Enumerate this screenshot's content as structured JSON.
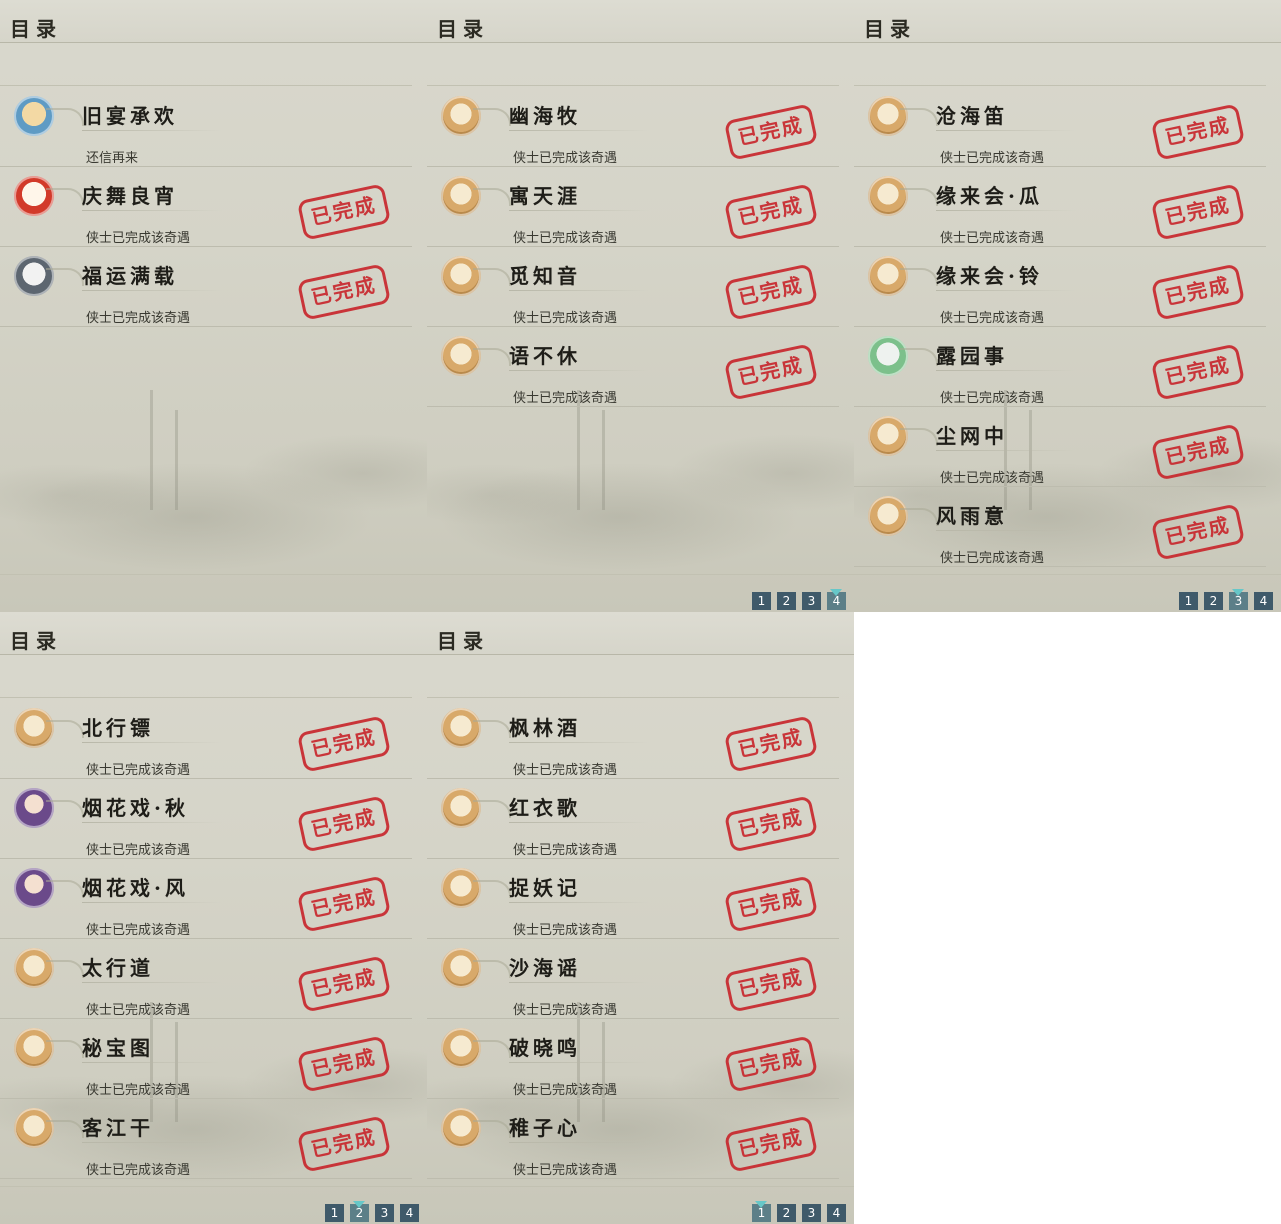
{
  "panels": [
    {
      "title": "目录",
      "entries": [
        {
          "name": "旧宴承欢",
          "status": "还信再来",
          "icon": "thumbs-up-icon",
          "completed": false
        },
        {
          "name": "庆舞良宵",
          "status": "侠士已完成该奇遇",
          "icon": "lion-dance-icon",
          "completed": true
        },
        {
          "name": "福运满载",
          "status": "侠士已完成该奇遇",
          "icon": "husky-pet-icon",
          "completed": true
        }
      ],
      "pages": []
    },
    {
      "title": "目录",
      "entries": [
        {
          "name": "幽海牧",
          "status": "侠士已完成该奇遇",
          "icon": "cat-icon",
          "completed": true
        },
        {
          "name": "寓天涯",
          "status": "侠士已完成该奇遇",
          "icon": "cat-icon",
          "completed": true
        },
        {
          "name": "觅知音",
          "status": "侠士已完成该奇遇",
          "icon": "cat-icon",
          "completed": true
        },
        {
          "name": "语不休",
          "status": "侠士已完成该奇遇",
          "icon": "cat-icon",
          "completed": true
        }
      ],
      "pages": [
        "1",
        "2",
        "3",
        "4"
      ],
      "active_page": "4"
    },
    {
      "title": "目录",
      "entries": [
        {
          "name": "沧海笛",
          "status": "侠士已完成该奇遇",
          "icon": "cat-icon",
          "completed": true
        },
        {
          "name": "缘来会·瓜",
          "status": "侠士已完成该奇遇",
          "icon": "cat-icon",
          "completed": true
        },
        {
          "name": "缘来会·铃",
          "status": "侠士已完成该奇遇",
          "icon": "cat-icon",
          "completed": true
        },
        {
          "name": "露园事",
          "status": "侠士已完成该奇遇",
          "icon": "deer-pet-icon",
          "completed": true
        },
        {
          "name": "尘网中",
          "status": "侠士已完成该奇遇",
          "icon": "cat-icon",
          "completed": true
        },
        {
          "name": "风雨意",
          "status": "侠士已完成该奇遇",
          "icon": "cat-icon",
          "completed": true
        }
      ],
      "pages": [
        "1",
        "2",
        "3",
        "4"
      ],
      "active_page": "3"
    },
    {
      "title": "目录",
      "entries": [
        {
          "name": "北行镖",
          "status": "侠士已完成该奇遇",
          "icon": "cat-icon",
          "completed": true
        },
        {
          "name": "烟花戏·秋",
          "status": "侠士已完成该奇遇",
          "icon": "girl-avatar-icon",
          "completed": true
        },
        {
          "name": "烟花戏·风",
          "status": "侠士已完成该奇遇",
          "icon": "girl-avatar-icon",
          "completed": true
        },
        {
          "name": "太行道",
          "status": "侠士已完成该奇遇",
          "icon": "cat-icon",
          "completed": true
        },
        {
          "name": "秘宝图",
          "status": "侠士已完成该奇遇",
          "icon": "cat-icon",
          "completed": true
        },
        {
          "name": "客江干",
          "status": "侠士已完成该奇遇",
          "icon": "cat-icon",
          "completed": true
        }
      ],
      "pages": [
        "1",
        "2",
        "3",
        "4"
      ],
      "active_page": "2"
    },
    {
      "title": "目录",
      "entries": [
        {
          "name": "枫林酒",
          "status": "侠士已完成该奇遇",
          "icon": "cat-icon",
          "completed": true
        },
        {
          "name": "红衣歌",
          "status": "侠士已完成该奇遇",
          "icon": "cat-icon",
          "completed": true
        },
        {
          "name": "捉妖记",
          "status": "侠士已完成该奇遇",
          "icon": "cat-icon",
          "completed": true
        },
        {
          "name": "沙海谣",
          "status": "侠士已完成该奇遇",
          "icon": "cat-icon",
          "completed": true
        },
        {
          "name": "破晓鸣",
          "status": "侠士已完成该奇遇",
          "icon": "cat-icon",
          "completed": true
        },
        {
          "name": "稚子心",
          "status": "侠士已完成该奇遇",
          "icon": "cat-icon",
          "completed": true
        }
      ],
      "pages": [
        "1",
        "2",
        "3",
        "4"
      ],
      "active_page": "1"
    }
  ],
  "stamp_label": "已完成",
  "colors": {
    "stamp": "#c8242a",
    "page_button": "#3f5a6a",
    "active_marker": "#66c7c8"
  }
}
